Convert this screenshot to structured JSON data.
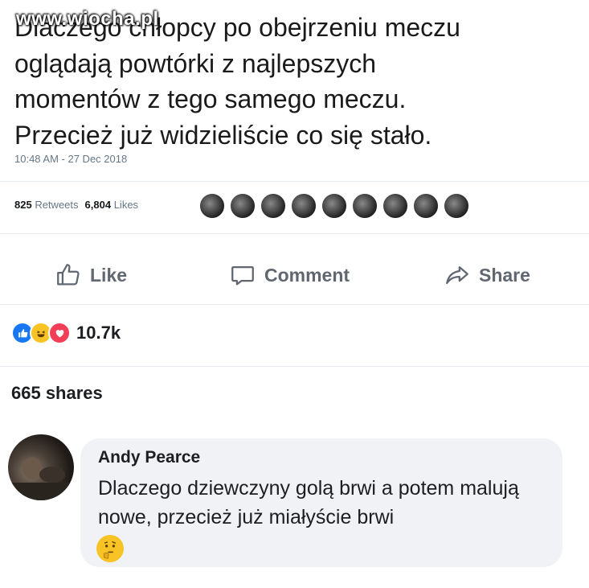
{
  "watermark": "www.wiocha.pl",
  "tweet": {
    "text": "Dlaczego chłopcy po obejrzeniu meczu\noglądają powtórki z najlepszych\nmomentów z tego samego meczu.\nPrzecież już widzieliście co się stało.",
    "timestamp": "10:48 AM - 27 Dec 2018",
    "retweets_count": "825",
    "retweets_label": "Retweets",
    "likes_count": "6,804",
    "likes_label": "Likes"
  },
  "actions": {
    "like_label": "Like",
    "comment_label": "Comment",
    "share_label": "Share"
  },
  "reactions": {
    "icons": [
      "like-reaction-icon",
      "haha-reaction-icon",
      "love-reaction-icon"
    ],
    "count": "10.7k"
  },
  "shares": "665 shares",
  "comment": {
    "author": "Andy Pearce",
    "text": "Dlaczego dziewczyny golą brwi a potem malują nowe, przecież już miałyście brwi",
    "emoji": "thinking-face-icon"
  },
  "colors": {
    "like_blue": "#1877f2",
    "haha_yellow": "#f7c325",
    "love_red": "#f33e58",
    "muted_text": "#606770",
    "bubble_bg": "#f0f2f5"
  }
}
